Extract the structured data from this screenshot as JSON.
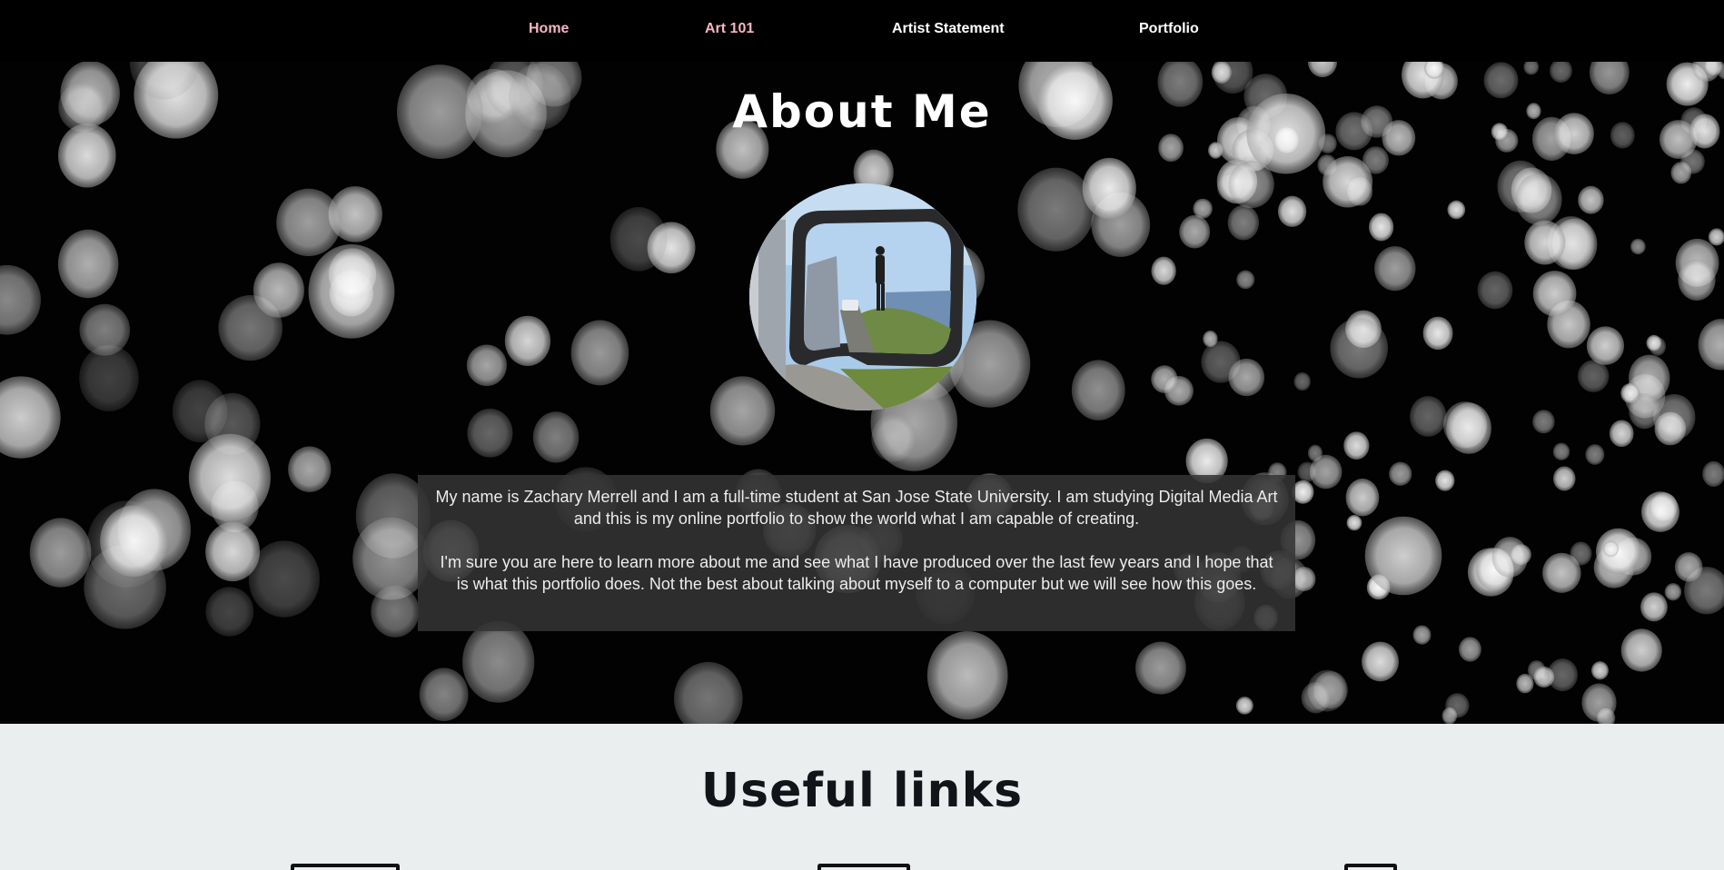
{
  "nav": {
    "items": [
      {
        "label": "Home"
      },
      {
        "label": "Art 101"
      },
      {
        "label": "Artist Statement"
      },
      {
        "label": "Portfolio"
      }
    ]
  },
  "hero": {
    "title": "About Me",
    "bio": [
      "My name is Zachary Merrell and I am a full-time student at San Jose State University. I am studying Digital Media Art and this is my online portfolio to show the world what I am capable of creating.",
      "I'm sure you are here to learn more about me and see what I have produced over the last few years and I hope that is what this portfolio does. Not the best about talking about myself to a computer but we will see how this goes."
    ]
  },
  "links": {
    "title": "Useful links",
    "icons": [
      "monitor-icon",
      "tablet-icon",
      "document-icon"
    ]
  },
  "colors": {
    "nav_background": "#000000",
    "nav_active": "#f4b6c5",
    "nav_text": "#ffffff",
    "links_background": "#eaeeef"
  }
}
